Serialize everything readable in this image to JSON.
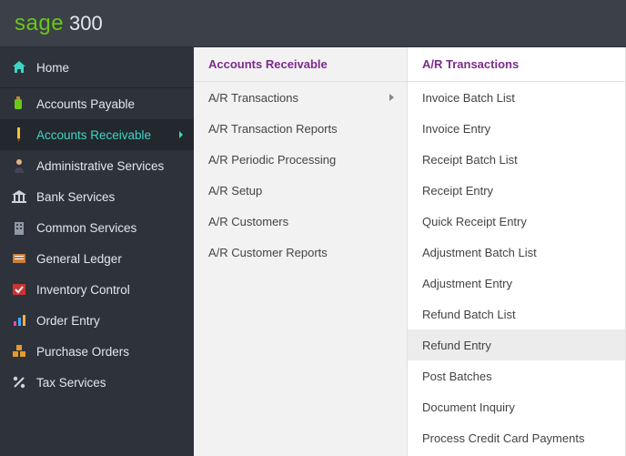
{
  "brand": {
    "name": "sage",
    "product": "300"
  },
  "sidebar": {
    "home": "Home",
    "items": [
      {
        "label": "Accounts Payable",
        "icon": "bottle"
      },
      {
        "label": "Accounts Receivable",
        "icon": "pen",
        "active": true
      },
      {
        "label": "Administrative Services",
        "icon": "person"
      },
      {
        "label": "Bank Services",
        "icon": "bank"
      },
      {
        "label": "Common Services",
        "icon": "building"
      },
      {
        "label": "General Ledger",
        "icon": "ledger"
      },
      {
        "label": "Inventory Control",
        "icon": "check"
      },
      {
        "label": "Order Entry",
        "icon": "chart"
      },
      {
        "label": "Purchase Orders",
        "icon": "boxes"
      },
      {
        "label": "Tax Services",
        "icon": "percent"
      }
    ]
  },
  "submenu1": {
    "title": "Accounts Receivable",
    "items": [
      "A/R Transactions",
      "A/R Transaction Reports",
      "A/R Periodic Processing",
      "A/R Setup",
      "A/R Customers",
      "A/R Customer Reports"
    ],
    "selected_index": 0
  },
  "submenu2": {
    "title": "A/R Transactions",
    "items": [
      "Invoice Batch List",
      "Invoice Entry",
      "Receipt Batch List",
      "Receipt Entry",
      "Quick Receipt Entry",
      "Adjustment Batch List",
      "Adjustment Entry",
      "Refund Batch List",
      "Refund Entry",
      "Post Batches",
      "Document Inquiry",
      "Process Credit Card Payments"
    ],
    "hover_index": 8
  }
}
